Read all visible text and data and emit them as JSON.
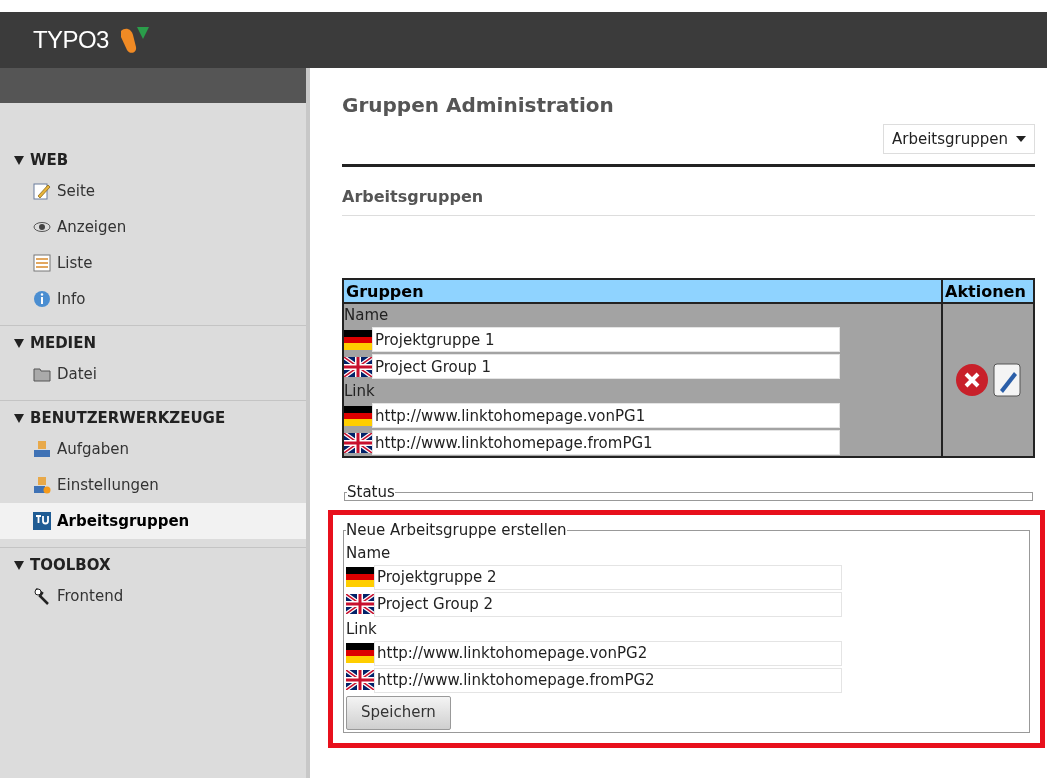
{
  "header": {
    "logo_text": "TYPO3"
  },
  "sidebar": {
    "sections": [
      {
        "title": "WEB",
        "expanded": true,
        "items": [
          {
            "label": "Seite",
            "selected": false
          },
          {
            "label": "Anzeigen",
            "selected": false
          },
          {
            "label": "Liste",
            "selected": false
          },
          {
            "label": "Info",
            "selected": false
          }
        ]
      },
      {
        "title": "MEDIEN",
        "expanded": true,
        "items": [
          {
            "label": "Datei",
            "selected": false
          }
        ]
      },
      {
        "title": "BENUTZERWERKZEUGE",
        "expanded": true,
        "items": [
          {
            "label": "Aufgaben",
            "selected": false
          },
          {
            "label": "Einstellungen",
            "selected": false
          },
          {
            "label": "Arbeitsgruppen",
            "selected": true
          }
        ]
      },
      {
        "title": "TOOLBOX",
        "expanded": true,
        "items": [
          {
            "label": "Frontend",
            "selected": false
          }
        ]
      }
    ]
  },
  "main": {
    "title": "Gruppen Administration",
    "function_select": "Arbeitsgruppen",
    "section_title": "Arbeitsgruppen",
    "table": {
      "columns": [
        "Gruppen",
        "Aktionen"
      ],
      "rows": [
        {
          "groups": [
            {
              "label": "Name",
              "fields": [
                {
                  "value": "Projektgruppe 1"
                },
                {
                  "value": "Project Group 1"
                }
              ]
            },
            {
              "label": "Link",
              "fields": [
                {
                  "value": "http://www.linktohomepage.vonPG1"
                },
                {
                  "value": "http://www.linktohomepage.fromPG1"
                }
              ]
            }
          ]
        }
      ]
    },
    "status": {
      "legend": "Status"
    },
    "new_group": {
      "legend": "Neue Arbeitsgruppe erstellen",
      "highlighted": true,
      "groups": [
        {
          "label": "Name",
          "fields": [
            {
              "value": "Projektgruppe 2"
            },
            {
              "value": "Project Group 2"
            }
          ]
        },
        {
          "label": "Link",
          "fields": [
            {
              "value": "http://www.linktohomepage.vonPG2"
            },
            {
              "value": "http://www.linktohomepage.fromPG2"
            }
          ]
        }
      ],
      "button": "Speichern"
    }
  }
}
